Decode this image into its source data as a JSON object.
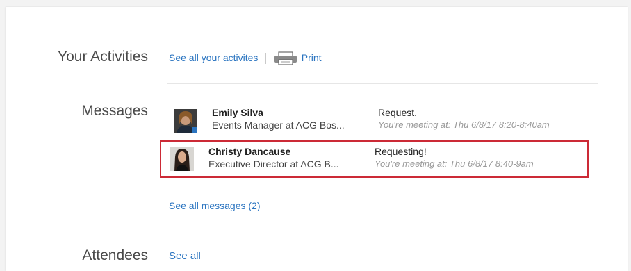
{
  "activities": {
    "heading": "Your Activities",
    "see_all_label": "See all your activites",
    "print_label": "Print"
  },
  "messages": {
    "heading": "Messages",
    "items": [
      {
        "name": "Emily Silva",
        "title": "Events Manager at ACG Bos...",
        "subject": "Request.",
        "meeting": "You're meeting at: Thu 6/8/17 8:20-8:40am"
      },
      {
        "name": "Christy Dancause",
        "title": "Executive Director at ACG B...",
        "subject": "Requesting!",
        "meeting": "You're meeting at: Thu 6/8/17 8:40-9am"
      }
    ],
    "see_all_label": "See all messages (2)"
  },
  "attendees": {
    "heading": "Attendees",
    "see_all_label": "See all"
  },
  "colors": {
    "link": "#2a74c0",
    "highlight_border": "#cc2a36"
  },
  "icons": {
    "print": "printer-icon"
  }
}
